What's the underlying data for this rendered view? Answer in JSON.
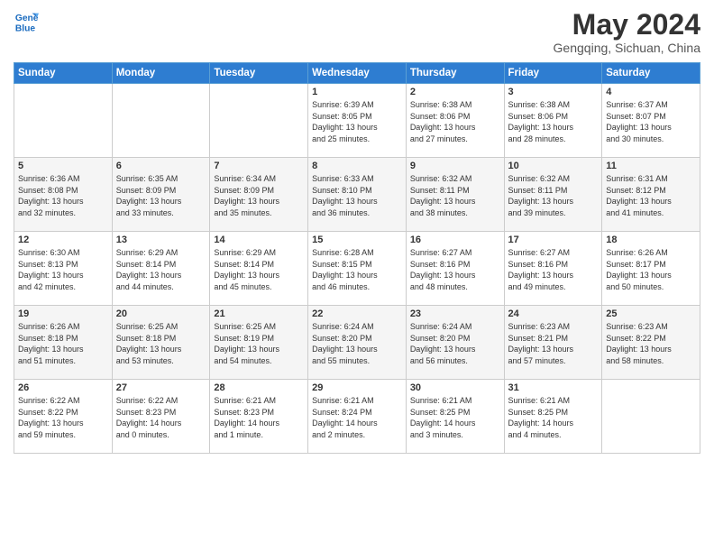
{
  "header": {
    "logo_line1": "General",
    "logo_line2": "Blue",
    "month_year": "May 2024",
    "location": "Gengqing, Sichuan, China"
  },
  "weekdays": [
    "Sunday",
    "Monday",
    "Tuesday",
    "Wednesday",
    "Thursday",
    "Friday",
    "Saturday"
  ],
  "weeks": [
    [
      {
        "day": "",
        "info": ""
      },
      {
        "day": "",
        "info": ""
      },
      {
        "day": "",
        "info": ""
      },
      {
        "day": "1",
        "info": "Sunrise: 6:39 AM\nSunset: 8:05 PM\nDaylight: 13 hours\nand 25 minutes."
      },
      {
        "day": "2",
        "info": "Sunrise: 6:38 AM\nSunset: 8:06 PM\nDaylight: 13 hours\nand 27 minutes."
      },
      {
        "day": "3",
        "info": "Sunrise: 6:38 AM\nSunset: 8:06 PM\nDaylight: 13 hours\nand 28 minutes."
      },
      {
        "day": "4",
        "info": "Sunrise: 6:37 AM\nSunset: 8:07 PM\nDaylight: 13 hours\nand 30 minutes."
      }
    ],
    [
      {
        "day": "5",
        "info": "Sunrise: 6:36 AM\nSunset: 8:08 PM\nDaylight: 13 hours\nand 32 minutes."
      },
      {
        "day": "6",
        "info": "Sunrise: 6:35 AM\nSunset: 8:09 PM\nDaylight: 13 hours\nand 33 minutes."
      },
      {
        "day": "7",
        "info": "Sunrise: 6:34 AM\nSunset: 8:09 PM\nDaylight: 13 hours\nand 35 minutes."
      },
      {
        "day": "8",
        "info": "Sunrise: 6:33 AM\nSunset: 8:10 PM\nDaylight: 13 hours\nand 36 minutes."
      },
      {
        "day": "9",
        "info": "Sunrise: 6:32 AM\nSunset: 8:11 PM\nDaylight: 13 hours\nand 38 minutes."
      },
      {
        "day": "10",
        "info": "Sunrise: 6:32 AM\nSunset: 8:11 PM\nDaylight: 13 hours\nand 39 minutes."
      },
      {
        "day": "11",
        "info": "Sunrise: 6:31 AM\nSunset: 8:12 PM\nDaylight: 13 hours\nand 41 minutes."
      }
    ],
    [
      {
        "day": "12",
        "info": "Sunrise: 6:30 AM\nSunset: 8:13 PM\nDaylight: 13 hours\nand 42 minutes."
      },
      {
        "day": "13",
        "info": "Sunrise: 6:29 AM\nSunset: 8:14 PM\nDaylight: 13 hours\nand 44 minutes."
      },
      {
        "day": "14",
        "info": "Sunrise: 6:29 AM\nSunset: 8:14 PM\nDaylight: 13 hours\nand 45 minutes."
      },
      {
        "day": "15",
        "info": "Sunrise: 6:28 AM\nSunset: 8:15 PM\nDaylight: 13 hours\nand 46 minutes."
      },
      {
        "day": "16",
        "info": "Sunrise: 6:27 AM\nSunset: 8:16 PM\nDaylight: 13 hours\nand 48 minutes."
      },
      {
        "day": "17",
        "info": "Sunrise: 6:27 AM\nSunset: 8:16 PM\nDaylight: 13 hours\nand 49 minutes."
      },
      {
        "day": "18",
        "info": "Sunrise: 6:26 AM\nSunset: 8:17 PM\nDaylight: 13 hours\nand 50 minutes."
      }
    ],
    [
      {
        "day": "19",
        "info": "Sunrise: 6:26 AM\nSunset: 8:18 PM\nDaylight: 13 hours\nand 51 minutes."
      },
      {
        "day": "20",
        "info": "Sunrise: 6:25 AM\nSunset: 8:18 PM\nDaylight: 13 hours\nand 53 minutes."
      },
      {
        "day": "21",
        "info": "Sunrise: 6:25 AM\nSunset: 8:19 PM\nDaylight: 13 hours\nand 54 minutes."
      },
      {
        "day": "22",
        "info": "Sunrise: 6:24 AM\nSunset: 8:20 PM\nDaylight: 13 hours\nand 55 minutes."
      },
      {
        "day": "23",
        "info": "Sunrise: 6:24 AM\nSunset: 8:20 PM\nDaylight: 13 hours\nand 56 minutes."
      },
      {
        "day": "24",
        "info": "Sunrise: 6:23 AM\nSunset: 8:21 PM\nDaylight: 13 hours\nand 57 minutes."
      },
      {
        "day": "25",
        "info": "Sunrise: 6:23 AM\nSunset: 8:22 PM\nDaylight: 13 hours\nand 58 minutes."
      }
    ],
    [
      {
        "day": "26",
        "info": "Sunrise: 6:22 AM\nSunset: 8:22 PM\nDaylight: 13 hours\nand 59 minutes."
      },
      {
        "day": "27",
        "info": "Sunrise: 6:22 AM\nSunset: 8:23 PM\nDaylight: 14 hours\nand 0 minutes."
      },
      {
        "day": "28",
        "info": "Sunrise: 6:21 AM\nSunset: 8:23 PM\nDaylight: 14 hours\nand 1 minute."
      },
      {
        "day": "29",
        "info": "Sunrise: 6:21 AM\nSunset: 8:24 PM\nDaylight: 14 hours\nand 2 minutes."
      },
      {
        "day": "30",
        "info": "Sunrise: 6:21 AM\nSunset: 8:25 PM\nDaylight: 14 hours\nand 3 minutes."
      },
      {
        "day": "31",
        "info": "Sunrise: 6:21 AM\nSunset: 8:25 PM\nDaylight: 14 hours\nand 4 minutes."
      },
      {
        "day": "",
        "info": ""
      }
    ]
  ]
}
